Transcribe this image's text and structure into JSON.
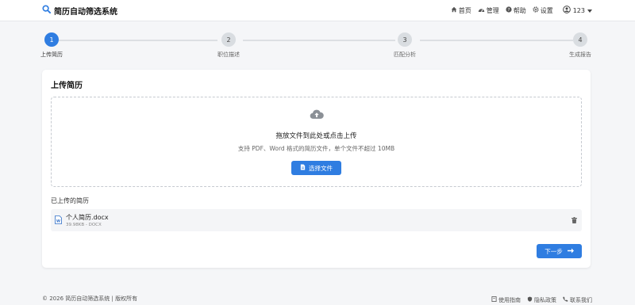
{
  "app": {
    "title": "简历自动筛选系统",
    "brand_color": "#2f7de1"
  },
  "nav": {
    "items": [
      {
        "label": "首页",
        "icon": "home-icon"
      },
      {
        "label": "管理",
        "icon": "dashboard-icon"
      },
      {
        "label": "帮助",
        "icon": "help-icon"
      },
      {
        "label": "设置",
        "icon": "gear-icon"
      }
    ],
    "user": {
      "name": "123",
      "icon": "user-circle-icon"
    }
  },
  "steps": [
    {
      "number": "1",
      "label": "上传简历",
      "state": "active"
    },
    {
      "number": "2",
      "label": "职位描述",
      "state": "pending"
    },
    {
      "number": "3",
      "label": "匹配分析",
      "state": "pending"
    },
    {
      "number": "4",
      "label": "生成报告",
      "state": "pending"
    }
  ],
  "upload": {
    "card_title": "上传简历",
    "drop_title": "拖放文件到此处或点击上传",
    "drop_subtitle": "支持 PDF、Word 格式的简历文件，单个文件不超过 10MB",
    "select_button": "选择文件",
    "uploaded_title": "已上传的简历",
    "files": [
      {
        "name": "个人简历.docx",
        "meta": "39.98KB - DOCX"
      }
    ],
    "next_button": "下一步"
  },
  "footer": {
    "copyright": "© 2026 简历自动筛选系统 | 版权所有",
    "links": [
      {
        "label": "使用指南",
        "icon": "book-icon"
      },
      {
        "label": "隐私政策",
        "icon": "shield-icon"
      },
      {
        "label": "联系我们",
        "icon": "phone-icon"
      }
    ]
  }
}
